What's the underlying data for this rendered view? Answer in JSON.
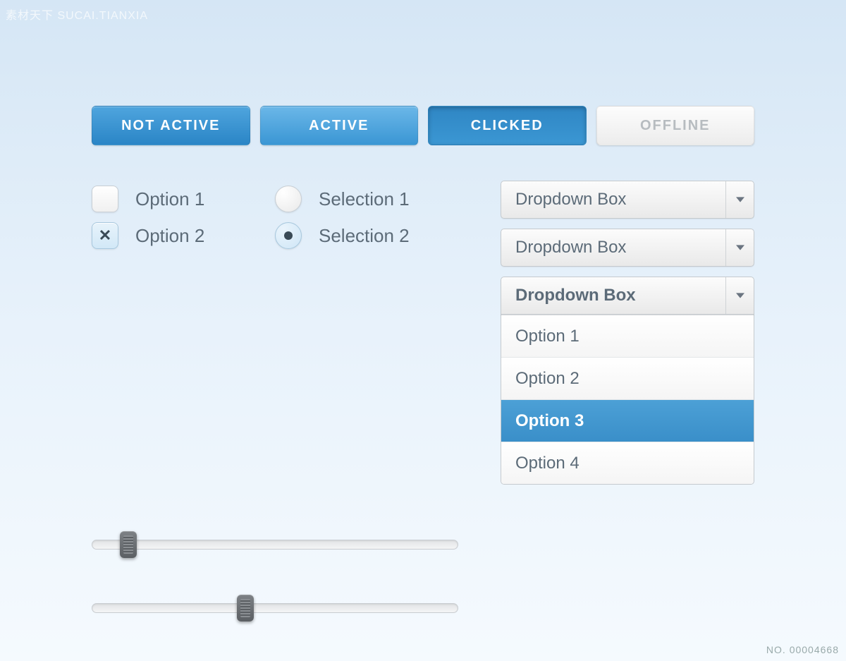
{
  "watermarks": {
    "top_left": "素材天下 SUCAI.TIANXIA",
    "bottom_right": "NO. 00004668"
  },
  "buttons": [
    {
      "label": "NOT ACTIVE",
      "state": "not-active"
    },
    {
      "label": "ACTIVE",
      "state": "active"
    },
    {
      "label": "CLICKED",
      "state": "clicked"
    },
    {
      "label": "OFFLINE",
      "state": "offline"
    }
  ],
  "checkboxes": [
    {
      "label": "Option 1",
      "checked": false
    },
    {
      "label": "Option 2",
      "checked": true
    }
  ],
  "radios": [
    {
      "label": "Selection 1",
      "selected": false
    },
    {
      "label": "Selection 2",
      "selected": true
    }
  ],
  "dropdowns": {
    "closed_label": "Dropdown Box",
    "open": {
      "label": "Dropdown Box",
      "options": [
        "Option 1",
        "Option 2",
        "Option 3",
        "Option 4"
      ],
      "selected_index": 2
    }
  },
  "sliders": [
    {
      "value_percent": 10
    },
    {
      "value_percent": 42
    }
  ],
  "colors": {
    "primary_blue": "#3a96d4",
    "selected_blue": "#3a8fc9",
    "text_muted": "#5c6b78"
  }
}
